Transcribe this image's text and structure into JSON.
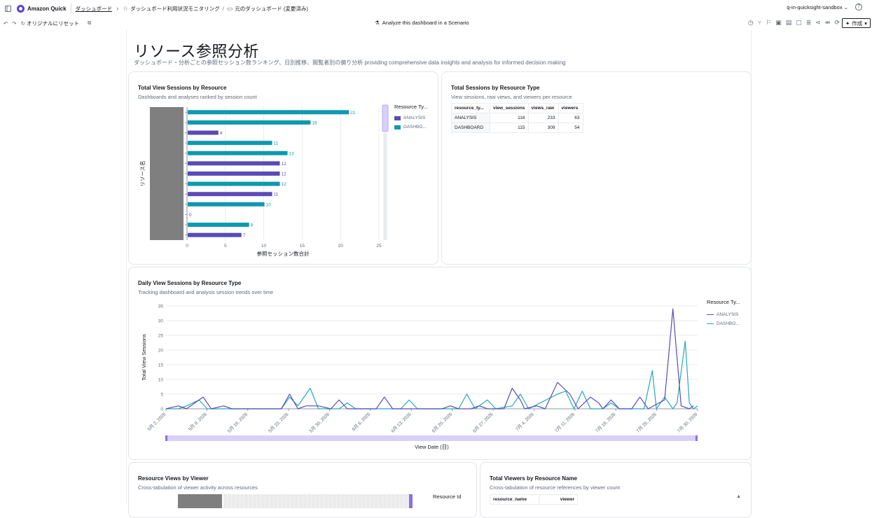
{
  "topbar": {
    "app_name": "Amazon Quick",
    "breadcrumb_dashboards": "ダッシュボード",
    "breadcrumb_parent": "ダッシュボード利用状況モニタリング",
    "breadcrumb_separator": "/",
    "breadcrumb_current": "元のダッシュボード (変更済み)",
    "account": "q-in-quicksight-sandbox"
  },
  "toolbar": {
    "reset_label": "オリジナルにリセット",
    "scenario_label": "Analyze this dashboard in a Scenario",
    "create_label": "作成"
  },
  "page": {
    "title": "リソース参照分析",
    "subtitle": "ダッシュボード・分析ごとの参照セッション数ランキング、日別推移、閲覧者別の偏り分析 providing comprehensive data insights and analysis for informed decision making"
  },
  "card_sessions_by_resource": {
    "title": "Total View Sessions by Resource",
    "subtitle": "Dashboards and analyses ranked by session count",
    "legend_title": "Resource Ty...",
    "legend": [
      {
        "label": "ANALYSIS",
        "color": "#5a4bb8"
      },
      {
        "label": "DASHBO...",
        "color": "#0f98b0"
      }
    ]
  },
  "card_sessions_by_type": {
    "title": "Total Sessions by Resource Type",
    "subtitle": "View sessions, raw views, and viewers per resource",
    "columns": [
      "resource_ty...",
      "view_sessions",
      "views_raw",
      "viewers"
    ],
    "rows": [
      [
        "ANALYSIS",
        "116",
        "233",
        "63"
      ],
      [
        "DASHBOARD",
        "115",
        "309",
        "54"
      ]
    ]
  },
  "card_daily": {
    "title": "Daily View Sessions by Resource Type",
    "subtitle": "Tracking dashboard and analysis session trends over time",
    "legend_title": "Resource Ty...",
    "legend": [
      {
        "label": "ANALYSIS",
        "color": "#5a4bb8"
      },
      {
        "label": "DASHBO...",
        "color": "#26a8b8"
      }
    ]
  },
  "card_views_by_viewer": {
    "title": "Resource Views by Viewer",
    "subtitle": "Cross-tabulation of viewer activity across resources",
    "legend_title": "Resource Id"
  },
  "card_viewers_by_name": {
    "title": "Total Viewers by Resource Name",
    "subtitle": "Cross-tabulation of resource references by viewer count",
    "columns": [
      "resource_name",
      "viewer"
    ]
  },
  "chart_data": [
    {
      "type": "bar",
      "orientation": "horizontal",
      "title": "Total View Sessions by Resource",
      "xlabel": "参照セッション数合計",
      "ylabel": "リソース名",
      "xlim": [
        0,
        25
      ],
      "xticks": [
        "0",
        "5",
        "10",
        "15",
        "20",
        "25"
      ],
      "grid": true,
      "legend_position": "right",
      "series_colors": {
        "ANALYSIS": "#5a4bb8",
        "DASHBOARD": "#0f98b0"
      },
      "bars": [
        {
          "series": "DASHBOARD",
          "value": 21
        },
        {
          "series": "DASHBOARD",
          "value": 16
        },
        {
          "series": "ANALYSIS",
          "value": 4
        },
        {
          "series": "DASHBOARD",
          "value": 11
        },
        {
          "series": "DASHBOARD",
          "value": 13
        },
        {
          "series": "ANALYSIS",
          "value": 12
        },
        {
          "series": "ANALYSIS",
          "value": 12
        },
        {
          "series": "DASHBOARD",
          "value": 12
        },
        {
          "series": "ANALYSIS",
          "value": 11
        },
        {
          "series": "DASHBOARD",
          "value": 10
        },
        {
          "series": "ANALYSIS",
          "value": 0
        },
        {
          "series": "DASHBOARD",
          "value": 8
        },
        {
          "series": "ANALYSIS",
          "value": 7
        }
      ]
    },
    {
      "type": "line",
      "title": "Daily View Sessions by Resource Type",
      "xlabel": "View Date (日)",
      "ylabel": "Total View Sessions",
      "ylim": [
        0,
        35
      ],
      "yticks": [
        "0",
        "5",
        "10",
        "15",
        "20",
        "25",
        "30",
        "35"
      ],
      "xticks": [
        "5月 2, 2026",
        "5月 9, 2026",
        "5月 16, 2026",
        "5月 23, 2026",
        "5月 30, 2026",
        "6月 6, 2026",
        "6月 13, 2026",
        "6月 20, 2026",
        "6月 27, 2026",
        "7月 4, 2026",
        "7月 11, 2026",
        "7月 18, 2026",
        "7月 25, 2026",
        "7月 30, 2026"
      ],
      "x_range": [
        "2026-05-02",
        "2026-07-31"
      ],
      "grid": true,
      "legend_position": "top-right",
      "series": [
        {
          "name": "ANALYSIS",
          "color": "#5a4bb8",
          "points": [
            [
              "2026-05-02",
              0
            ],
            [
              "2026-05-05",
              1
            ],
            [
              "2026-05-07",
              0
            ],
            [
              "2026-05-11",
              4
            ],
            [
              "2026-05-13",
              0
            ],
            [
              "2026-05-16",
              1
            ],
            [
              "2026-05-18",
              0
            ],
            [
              "2026-05-30",
              0
            ],
            [
              "2026-06-01",
              5
            ],
            [
              "2026-06-03",
              0
            ],
            [
              "2026-06-05",
              1
            ],
            [
              "2026-06-08",
              1
            ],
            [
              "2026-06-11",
              0
            ],
            [
              "2026-06-13",
              3
            ],
            [
              "2026-06-15",
              0
            ],
            [
              "2026-06-22",
              0
            ],
            [
              "2026-06-24",
              4
            ],
            [
              "2026-06-26",
              0
            ],
            [
              "2026-07-08",
              0
            ],
            [
              "2026-07-10",
              1
            ],
            [
              "2026-07-12",
              0
            ],
            [
              "2026-07-15",
              0
            ],
            [
              "2026-07-17",
              1
            ],
            [
              "2026-07-19",
              0
            ],
            [
              "2026-07-23",
              0
            ],
            [
              "2026-07-25",
              7
            ],
            [
              "2026-07-27",
              3
            ],
            [
              "2026-07-28",
              0
            ],
            [
              "2026-07-31",
              1
            ],
            [
              "2026-08-02",
              0
            ],
            [
              "2026-08-05",
              9
            ],
            [
              "2026-08-08",
              5
            ],
            [
              "2026-08-10",
              0
            ],
            [
              "2026-08-13",
              4
            ],
            [
              "2026-08-15",
              2
            ],
            [
              "2026-08-16",
              0
            ],
            [
              "2026-08-18",
              3
            ],
            [
              "2026-08-20",
              0
            ],
            [
              "2026-08-23",
              0
            ],
            [
              "2026-08-25",
              4
            ],
            [
              "2026-08-27",
              0
            ],
            [
              "2026-08-31",
              3
            ],
            [
              "2026-09-02",
              34
            ],
            [
              "2026-09-04",
              1
            ],
            [
              "2026-09-06",
              0
            ],
            [
              "2026-09-07",
              1
            ]
          ]
        },
        {
          "name": "DASHBOARD",
          "color": "#26a8b8",
          "points": [
            [
              "2026-05-02",
              0
            ],
            [
              "2026-05-05",
              0
            ],
            [
              "2026-05-07",
              1
            ],
            [
              "2026-05-10",
              3
            ],
            [
              "2026-05-12",
              0
            ],
            [
              "2026-05-30",
              0
            ],
            [
              "2026-06-01",
              4
            ],
            [
              "2026-06-03",
              1
            ],
            [
              "2026-06-06",
              7
            ],
            [
              "2026-06-08",
              0
            ],
            [
              "2026-06-13",
              0
            ],
            [
              "2026-06-15",
              2
            ],
            [
              "2026-06-17",
              0
            ],
            [
              "2026-06-28",
              0
            ],
            [
              "2026-06-30",
              3
            ],
            [
              "2026-07-02",
              0
            ],
            [
              "2026-07-12",
              0
            ],
            [
              "2026-07-14",
              5
            ],
            [
              "2026-07-16",
              0
            ],
            [
              "2026-07-19",
              3
            ],
            [
              "2026-07-21",
              0
            ],
            [
              "2026-07-25",
              1
            ],
            [
              "2026-07-27",
              5
            ],
            [
              "2026-07-29",
              0
            ],
            [
              "2026-08-05",
              5
            ],
            [
              "2026-08-07",
              6
            ],
            [
              "2026-08-09",
              0
            ],
            [
              "2026-08-11",
              6
            ],
            [
              "2026-08-13",
              0
            ],
            [
              "2026-08-16",
              0
            ],
            [
              "2026-08-18",
              2
            ],
            [
              "2026-08-20",
              0
            ],
            [
              "2026-08-26",
              0
            ],
            [
              "2026-08-28",
              13
            ],
            [
              "2026-08-29",
              0
            ],
            [
              "2026-08-31",
              4
            ],
            [
              "2026-09-02",
              0
            ],
            [
              "2026-09-03",
              2
            ],
            [
              "2026-09-05",
              23
            ],
            [
              "2026-09-06",
              2
            ],
            [
              "2026-09-07",
              0
            ],
            [
              "2026-09-08",
              1
            ]
          ]
        }
      ]
    }
  ]
}
